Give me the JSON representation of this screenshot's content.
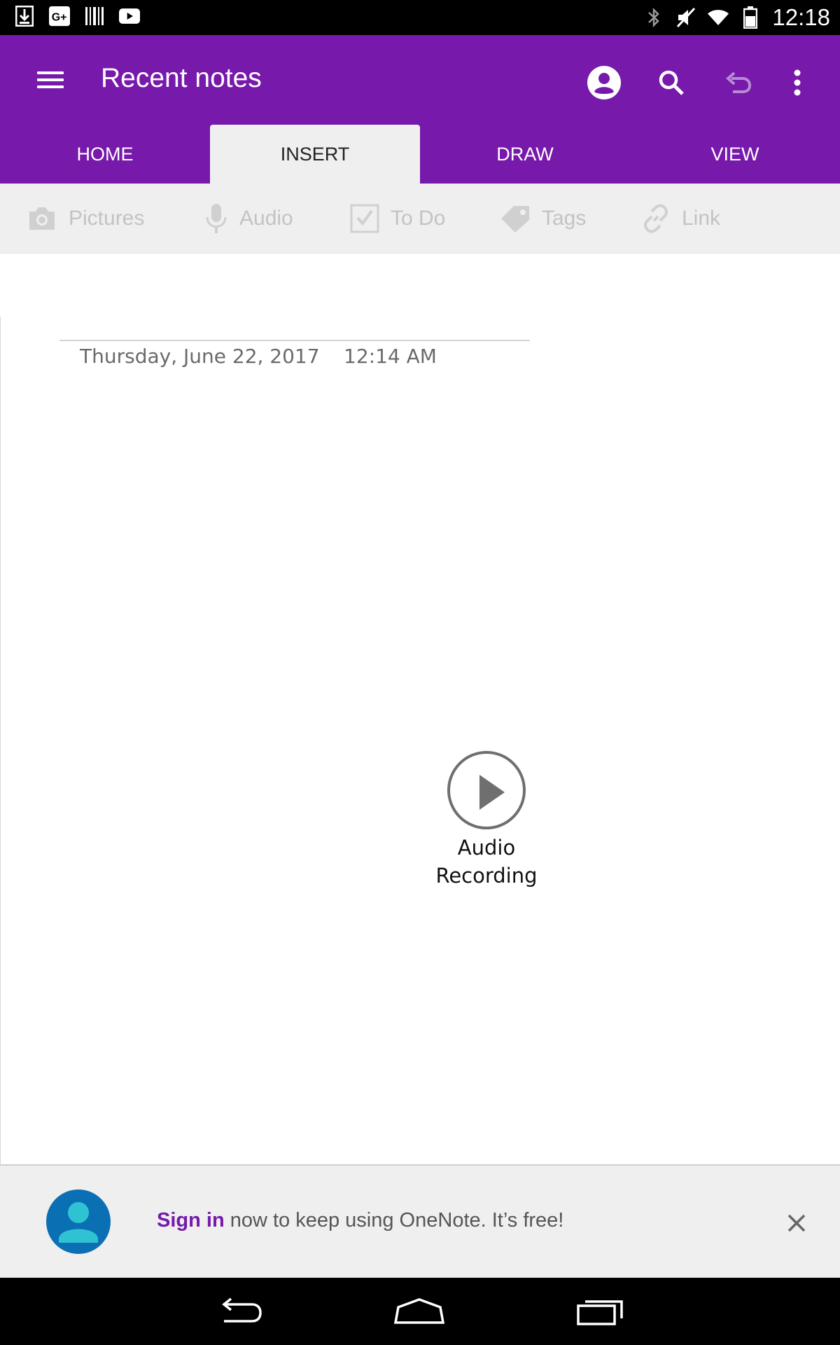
{
  "status_bar": {
    "time": "12:18",
    "left_icons": [
      "download-icon",
      "google-plus-icon",
      "barcode-icon",
      "youtube-icon"
    ],
    "right_icons": [
      "bluetooth-icon",
      "mute-icon",
      "wifi-icon",
      "battery-icon"
    ]
  },
  "app_bar": {
    "title": "Recent notes",
    "accent_color": "#7719aa",
    "actions": [
      "account-icon",
      "search-icon",
      "undo-icon",
      "more-vert-icon"
    ]
  },
  "tabs": [
    {
      "label": "HOME",
      "active": false
    },
    {
      "label": "INSERT",
      "active": true
    },
    {
      "label": "DRAW",
      "active": false
    },
    {
      "label": "VIEW",
      "active": false
    }
  ],
  "ribbon": {
    "items": [
      {
        "label": "Pictures",
        "icon": "camera-icon"
      },
      {
        "label": "Audio",
        "icon": "microphone-icon"
      },
      {
        "label": "To Do",
        "icon": "checkbox-icon"
      },
      {
        "label": "Tags",
        "icon": "tag-icon"
      },
      {
        "label": "Link",
        "icon": "link-icon"
      }
    ]
  },
  "page": {
    "date": "Thursday, June 22, 2017",
    "time": "12:14 AM",
    "attachment": {
      "icon": "play-icon",
      "label_line1": "Audio",
      "label_line2": "Recording"
    }
  },
  "banner": {
    "link": "Sign in",
    "message": " now to keep using OneNote. It’s free!",
    "icon": "user-avatar-icon"
  },
  "nav_bar": {
    "buttons": [
      "back-icon",
      "home-icon",
      "recents-icon"
    ]
  }
}
